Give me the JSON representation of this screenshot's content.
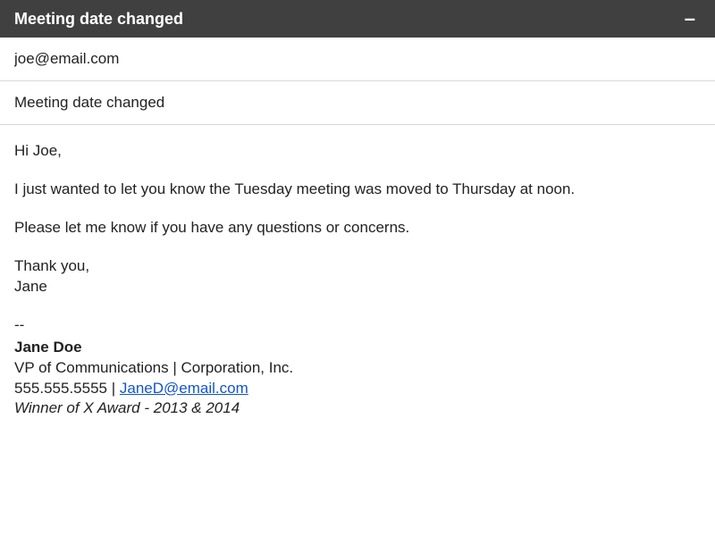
{
  "header": {
    "title": "Meeting date changed",
    "minimize_glyph": "–"
  },
  "fields": {
    "to_value": "joe@email.com",
    "subject_value": "Meeting date changed"
  },
  "body": {
    "greeting": "Hi Joe,",
    "para1": "I just wanted to let you know the Tuesday meeting was moved to Thursday at noon.",
    "para2": "Please let me know if you have any questions or concerns.",
    "closing_thanks": "Thank you,",
    "closing_name": "Jane"
  },
  "signature": {
    "divider": "--",
    "name": "Jane Doe",
    "title_line": "VP of Communications | Corporation, Inc.",
    "phone": "555.555.5555",
    "sep": " | ",
    "email": "JaneD@email.com",
    "award": "Winner of X Award - 2013 & 2014"
  }
}
